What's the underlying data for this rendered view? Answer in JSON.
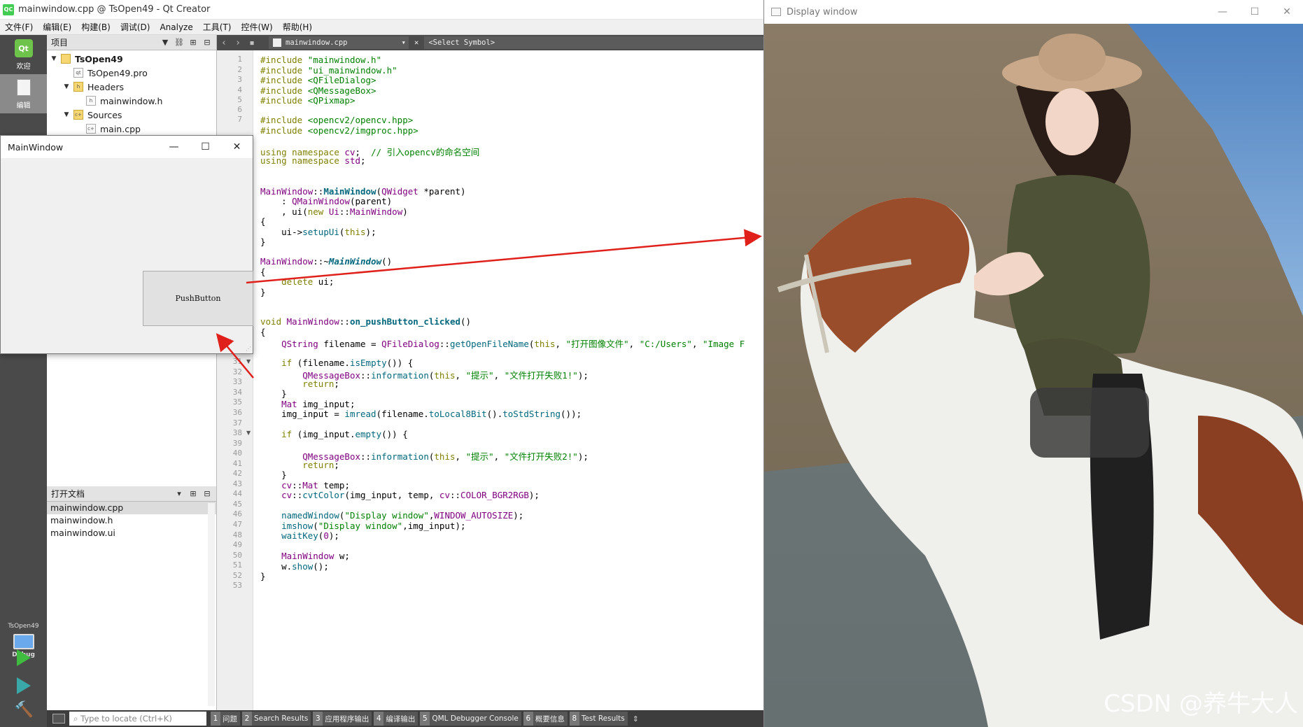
{
  "qt": {
    "title": "mainwindow.cpp @ TsOpen49 - Qt Creator",
    "menu": [
      "文件(F)",
      "编辑(E)",
      "构建(B)",
      "调试(D)",
      "Analyze",
      "工具(T)",
      "控件(W)",
      "帮助(H)"
    ],
    "modes": {
      "welcome": "欢迎",
      "edit": "编辑"
    },
    "kit": {
      "project": "TsOpen49",
      "config": "Debug"
    },
    "project_panel": {
      "title": "项目",
      "tree": {
        "root": "TsOpen49",
        "pro": "TsOpen49.pro",
        "headers": "Headers",
        "header_file": "mainwindow.h",
        "sources": "Sources",
        "source_file": "main.cpp"
      }
    },
    "open_docs": {
      "title": "打开文档",
      "items": [
        "mainwindow.cpp",
        "mainwindow.h",
        "mainwindow.ui"
      ]
    },
    "editor": {
      "file": "mainwindow.cpp",
      "symbol": "<Select Symbol>",
      "line_numbers": [
        "1",
        "2",
        "3",
        "4",
        "5",
        "6",
        "7",
        "",
        "",
        "",
        "",
        "",
        "",
        "",
        "",
        "",
        "",
        "",
        "",
        "",
        "",
        "",
        "",
        "",
        "",
        "",
        "27",
        "28",
        "29",
        "30",
        "31",
        "32",
        "33",
        "34",
        "35",
        "36",
        "37",
        "38",
        "39",
        "40",
        "41",
        "42",
        "43",
        "44",
        "45",
        "46",
        "47",
        "48",
        "49",
        "50",
        "51",
        "52",
        "53"
      ]
    },
    "locate_placeholder": "Type to locate (Ctrl+K)",
    "output_tabs": [
      {
        "num": "1",
        "label": "问题"
      },
      {
        "num": "2",
        "label": "Search Results"
      },
      {
        "num": "3",
        "label": "应用程序输出"
      },
      {
        "num": "4",
        "label": "编译输出"
      },
      {
        "num": "5",
        "label": "QML Debugger Console"
      },
      {
        "num": "6",
        "label": "概要信息"
      },
      {
        "num": "8",
        "label": "Test Results"
      }
    ]
  },
  "mainwindow": {
    "title": "MainWindow",
    "button": "PushButton"
  },
  "display": {
    "title": "Display window",
    "watermark": "CSDN @养牛大人"
  },
  "colors": {
    "modebar": "#4a4a4a",
    "keyword": "#808000",
    "string": "#008000",
    "type": "#800080",
    "function": "#00677c",
    "arrow": "#e0201b"
  }
}
